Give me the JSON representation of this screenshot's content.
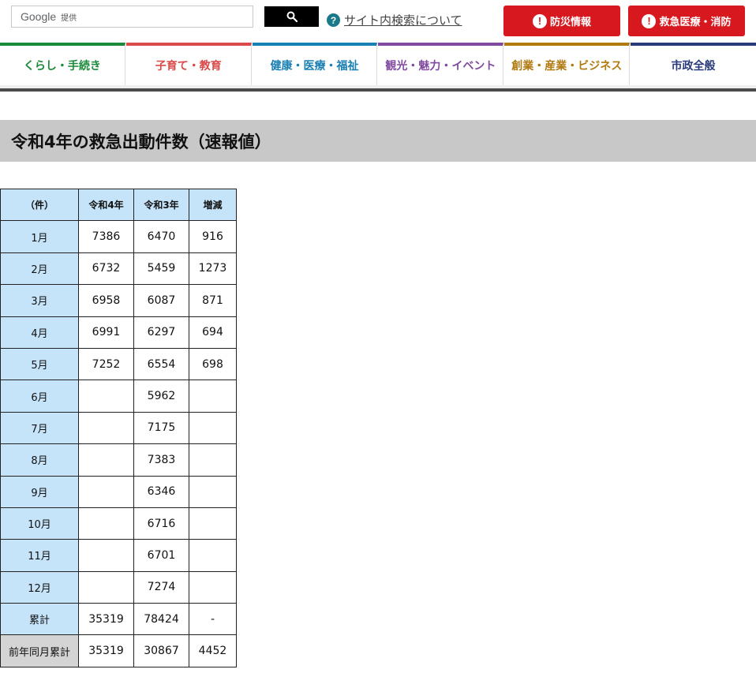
{
  "search": {
    "google_label": "Google",
    "provided_label": "提供",
    "help_link": "サイト内検索について"
  },
  "alerts": {
    "disaster_label": "防災情報",
    "emergency_label": "救急医療・消防"
  },
  "nav": [
    {
      "label": "くらし・手続き",
      "color": "#1a8a3a"
    },
    {
      "label": "子育て・教育",
      "color": "#d94a4a"
    },
    {
      "label": "健康・医療・福祉",
      "color": "#1a7fb3"
    },
    {
      "label": "観光・魅力・イベント",
      "color": "#7f4aa0"
    },
    {
      "label": "創業・産業・ビジネス",
      "color": "#b07a10"
    },
    {
      "label": "市政全般",
      "color": "#2a3a7a"
    }
  ],
  "page": {
    "title": "令和4年の救急出動件数（速報値）"
  },
  "table": {
    "headers": [
      "（件）",
      "令和4年",
      "令和3年",
      "増減"
    ],
    "rows": [
      {
        "label": "1月",
        "r4": "7386",
        "r3": "6470",
        "diff": "916"
      },
      {
        "label": "2月",
        "r4": "6732",
        "r3": "5459",
        "diff": "1273"
      },
      {
        "label": "3月",
        "r4": "6958",
        "r3": "6087",
        "diff": "871"
      },
      {
        "label": "4月",
        "r4": "6991",
        "r3": "6297",
        "diff": "694"
      },
      {
        "label": "5月",
        "r4": "7252",
        "r3": "6554",
        "diff": "698"
      },
      {
        "label": "6月",
        "r4": "",
        "r3": "5962",
        "diff": ""
      },
      {
        "label": "7月",
        "r4": "",
        "r3": "7175",
        "diff": ""
      },
      {
        "label": "8月",
        "r4": "",
        "r3": "7383",
        "diff": ""
      },
      {
        "label": "9月",
        "r4": "",
        "r3": "6346",
        "diff": ""
      },
      {
        "label": "10月",
        "r4": "",
        "r3": "6716",
        "diff": ""
      },
      {
        "label": "11月",
        "r4": "",
        "r3": "6701",
        "diff": ""
      },
      {
        "label": "12月",
        "r4": "",
        "r3": "7274",
        "diff": ""
      },
      {
        "label": "累計",
        "r4": "35319",
        "r3": "78424",
        "diff": "-"
      },
      {
        "label": "前年同月累計",
        "r4": "35319",
        "r3": "30867",
        "diff": "4452"
      }
    ]
  }
}
